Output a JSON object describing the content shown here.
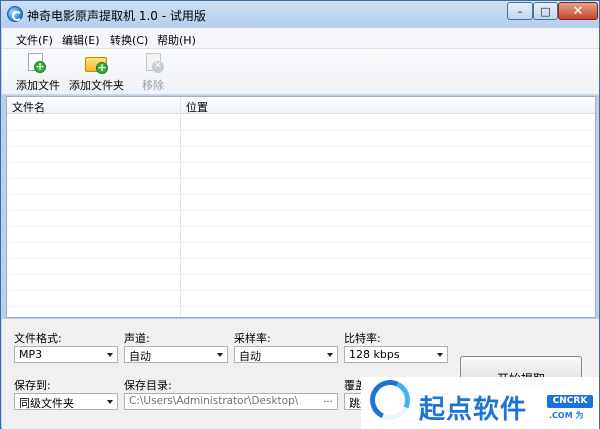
{
  "window": {
    "title": "神奇电影原声提取机 1.0 - 试用版",
    "controls": {
      "minimize": "–",
      "maximize": "□",
      "close": "✕"
    }
  },
  "menu": {
    "items": [
      "文件(F)",
      "编辑(E)",
      "转换(C)",
      "帮助(H)"
    ]
  },
  "toolbar": {
    "add_file": "添加文件",
    "add_folder": "添加文件夹",
    "remove": "移除"
  },
  "file_list": {
    "columns": [
      "文件名",
      "位置"
    ],
    "rows": []
  },
  "settings": {
    "format": {
      "label": "文件格式:",
      "value": "MP3"
    },
    "channel": {
      "label": "声道:",
      "value": "自动"
    },
    "sample_rate": {
      "label": "采样率:",
      "value": "自动"
    },
    "bitrate": {
      "label": "比特率:",
      "value": "128 kbps"
    },
    "save_to": {
      "label": "保存到:",
      "value": "同级文件夹"
    },
    "save_dir": {
      "label": "保存目录:",
      "value": "C:\\Users\\Administrator\\Desktop\\",
      "browse": "..."
    },
    "overwrite": {
      "label": "覆盖",
      "value": "跳过"
    },
    "start_button": "开始提取"
  },
  "watermark": {
    "text": "起点软件",
    "badge": "CNCRK",
    "sub": ".COM 为"
  },
  "colors": {
    "title_gradient_top": "#cfe0f3",
    "accent": "#1e73d6",
    "add_green": "#2fae3a"
  }
}
